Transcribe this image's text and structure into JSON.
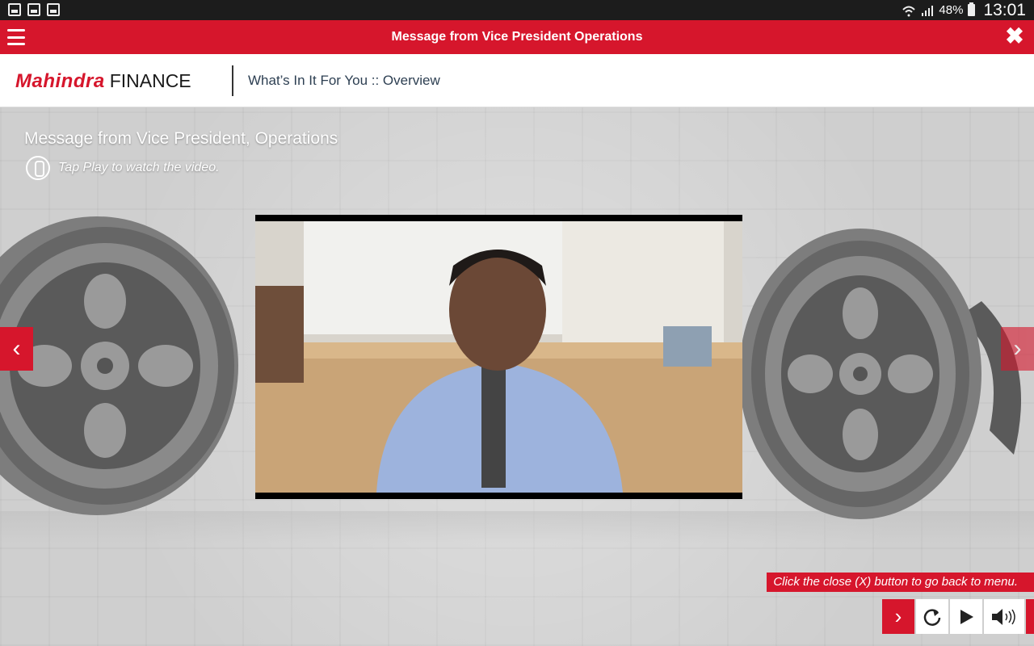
{
  "status_bar": {
    "notification_icons": [
      "gallery-icon",
      "phone-download-icon",
      "calendar-icon"
    ],
    "battery": "48%",
    "time": "13:01"
  },
  "titlebar": {
    "title": "Message from Vice President Operations"
  },
  "header": {
    "logo_brand": "Mahindra",
    "logo_suffix": "FINANCE",
    "breadcrumb": "What’s In It For You :: Overview"
  },
  "content": {
    "heading": "Message from Vice President, Operations",
    "instruction": "Tap Play to watch the video.",
    "hint": "Click the close (X) button to go back to menu."
  },
  "colors": {
    "accent": "#d6162c",
    "statusbar": "#1c1c1c",
    "background": "#cfcfcf"
  }
}
